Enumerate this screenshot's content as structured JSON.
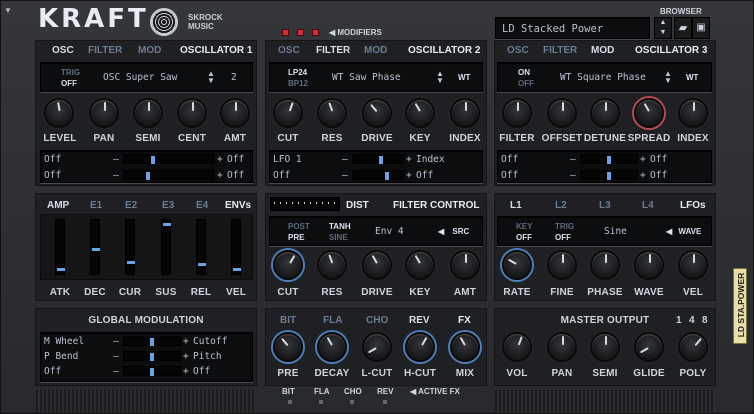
{
  "header": {
    "logo": "KRAFT",
    "brand_line1": "SKROCK",
    "brand_line2": "MUSIC",
    "modifiers": "MODIFIERS",
    "browser_label": "BROWSER",
    "preset_name": "LD Stacked Power"
  },
  "osc1": {
    "tabs": [
      "OSC",
      "FILTER",
      "MOD"
    ],
    "title": "OSCILLATOR 1",
    "trig_label": "TRIG",
    "trig_value": "OFF",
    "wave": "OSC Super Saw",
    "voices": "2",
    "knobs": [
      "LEVEL",
      "PAN",
      "SEMI",
      "CENT",
      "AMT"
    ],
    "mod_rows": [
      {
        "src": "Off",
        "dst": "Off"
      },
      {
        "src": "Off",
        "dst": "Off"
      }
    ]
  },
  "osc2": {
    "tabs": [
      "OSC",
      "FILTER",
      "MOD"
    ],
    "title": "OSCILLATOR 2",
    "filter_a": "LP24",
    "filter_b": "BP12",
    "wave": "WT Saw Phase",
    "wt_label": "WT",
    "knobs": [
      "CUT",
      "RES",
      "DRIVE",
      "KEY",
      "INDEX"
    ],
    "mod_rows": [
      {
        "src": "LFO 1",
        "dst": "Index"
      },
      {
        "src": "Off",
        "dst": "Off"
      }
    ]
  },
  "osc3": {
    "tabs": [
      "OSC",
      "FILTER",
      "MOD"
    ],
    "title": "OSCILLATOR 3",
    "on_label": "ON",
    "off_label": "OFF",
    "wave": "WT Square Phase",
    "wt_label": "WT",
    "knobs": [
      "FILTER",
      "OFFSET",
      "DETUNE",
      "SPREAD",
      "INDEX"
    ],
    "mod_rows": [
      {
        "src": "Off",
        "dst": "Off"
      },
      {
        "src": "Off",
        "dst": "Off"
      }
    ]
  },
  "env": {
    "tabs": [
      "AMP",
      "E1",
      "E2",
      "E3",
      "E4"
    ],
    "title": "ENVs",
    "sliders": [
      "ATK",
      "DEC",
      "CUR",
      "SUS",
      "REL",
      "VEL"
    ],
    "levels": [
      0.05,
      0.45,
      0.2,
      0.95,
      0.15,
      0.05
    ]
  },
  "filter": {
    "dist_label": "DIST",
    "title": "FILTER CONTROL",
    "post": "POST",
    "pre": "PRE",
    "tanh": "TANH",
    "sine": "SINE",
    "env": "Env 4",
    "src": "SRC",
    "knobs": [
      "CUT",
      "RES",
      "DRIVE",
      "KEY",
      "AMT"
    ]
  },
  "lfo": {
    "tabs": [
      "L1",
      "L2",
      "L3",
      "L4"
    ],
    "title": "LFOs",
    "key_label": "KEY",
    "key_value": "OFF",
    "trig_label": "TRIG",
    "trig_value": "OFF",
    "wave": "Sine",
    "wave_label": "WAVE",
    "knobs": [
      "RATE",
      "FINE",
      "PHASE",
      "WAVE",
      "VEL"
    ]
  },
  "globalmod": {
    "title": "GLOBAL MODULATION",
    "rows": [
      {
        "src": "M Wheel",
        "dst": "Cutoff"
      },
      {
        "src": "P Bend",
        "dst": "Pitch"
      },
      {
        "src": "Off",
        "dst": "Off"
      }
    ]
  },
  "fx": {
    "tabs": [
      "BIT",
      "FLA",
      "CHO",
      "REV"
    ],
    "title": "FX",
    "knobs": [
      "PRE",
      "DECAY",
      "L-CUT",
      "H-CUT",
      "MIX"
    ],
    "active": [
      "BIT",
      "FLA",
      "CHO",
      "REV"
    ],
    "active_label": "ACTIVE FX"
  },
  "master": {
    "title": "MASTER OUTPUT",
    "poly_opts": [
      "1",
      "4",
      "8"
    ],
    "knobs": [
      "VOL",
      "PAN",
      "SEMI",
      "GLIDE",
      "POLY"
    ]
  },
  "side_tag": "LD STA.POWER"
}
